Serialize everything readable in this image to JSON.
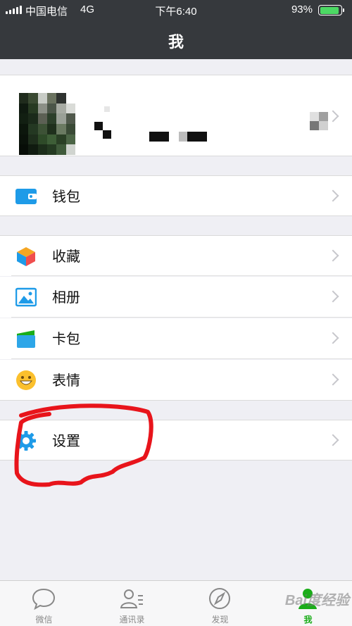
{
  "status_bar": {
    "carrier": "中国电信",
    "network": "4G",
    "time": "下午6:40",
    "battery_percent": "93%",
    "battery_level": 0.93
  },
  "nav": {
    "title": "我"
  },
  "profile": {
    "avatar": "pixelated-avatar",
    "qr_icon": "qr-code-icon"
  },
  "wallet_group": [
    {
      "label": "钱包",
      "icon": "wallet-icon"
    }
  ],
  "main_group": [
    {
      "label": "收藏",
      "icon": "favorites-cube-icon"
    },
    {
      "label": "相册",
      "icon": "album-icon"
    },
    {
      "label": "卡包",
      "icon": "card-package-icon"
    },
    {
      "label": "表情",
      "icon": "emoji-smile-icon"
    }
  ],
  "settings_group": [
    {
      "label": "设置",
      "icon": "gear-icon"
    }
  ],
  "tabbar": {
    "tabs": [
      {
        "label": "微信",
        "icon": "chat-bubble-icon",
        "active": false
      },
      {
        "label": "通讯录",
        "icon": "contacts-icon",
        "active": false
      },
      {
        "label": "发现",
        "icon": "compass-icon",
        "active": false
      },
      {
        "label": "我",
        "icon": "me-person-icon",
        "active": true
      }
    ]
  },
  "watermark": "Bai度经验",
  "colors": {
    "header_bg": "#36393D",
    "accent_green": "#1AAD19",
    "annotation_red": "#E8141B",
    "page_bg": "#EFEFF4"
  }
}
